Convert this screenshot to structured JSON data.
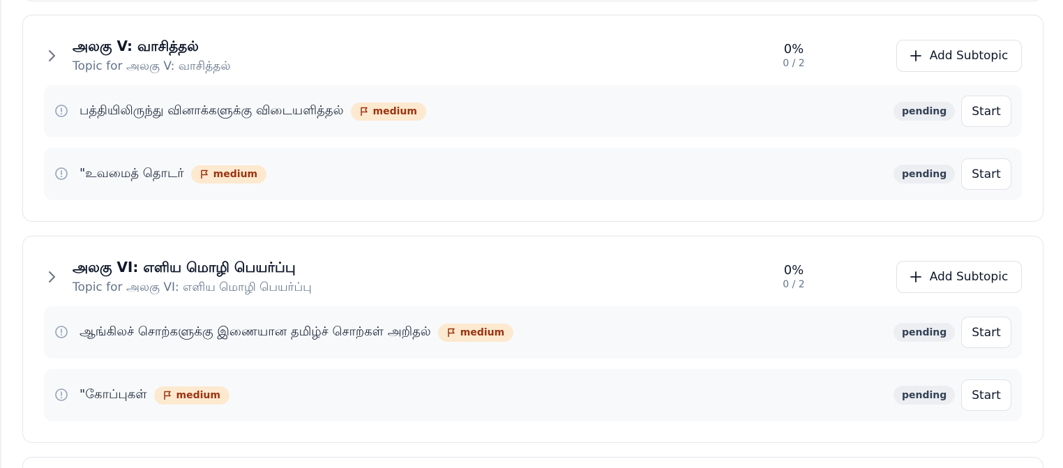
{
  "topics": [
    {
      "title": "அலகு V: வாசித்தல்",
      "subtitle": "Topic for அலகு V: வாசித்தல்",
      "progress_percent": "0%",
      "progress_count": "0 / 2",
      "add_label": "Add Subtopic",
      "subtopics": [
        {
          "label": "பத்தியிலிருந்து வினாக்களுக்கு விடையளித்தல்",
          "difficulty": "medium",
          "status": "pending",
          "action": "Start"
        },
        {
          "label": "\"உவமைத் தொடர்",
          "difficulty": "medium",
          "status": "pending",
          "action": "Start"
        }
      ]
    },
    {
      "title": "அலகு VI: எளிய மொழி பெயர்ப்பு",
      "subtitle": "Topic for அலகு VI: எளிய மொழி பெயர்ப்பு",
      "progress_percent": "0%",
      "progress_count": "0 / 2",
      "add_label": "Add Subtopic",
      "subtopics": [
        {
          "label": "ஆங்கிலச் சொற்களுக்கு இணையான தமிழ்ச் சொற்கள் அறிதல்",
          "difficulty": "medium",
          "status": "pending",
          "action": "Start"
        },
        {
          "label": "\"கோப்புகள்",
          "difficulty": "medium",
          "status": "pending",
          "action": "Start"
        }
      ]
    }
  ],
  "icons": {
    "expand": "chevron-right-icon",
    "add": "plus-icon",
    "status": "alert-circle-icon",
    "difficulty": "flag-icon"
  },
  "colors": {
    "badge_bg": "#fde9cf",
    "badge_text": "#9a3412",
    "subtopic_bg": "#f8f9fb",
    "status_bg": "#eceef2"
  }
}
